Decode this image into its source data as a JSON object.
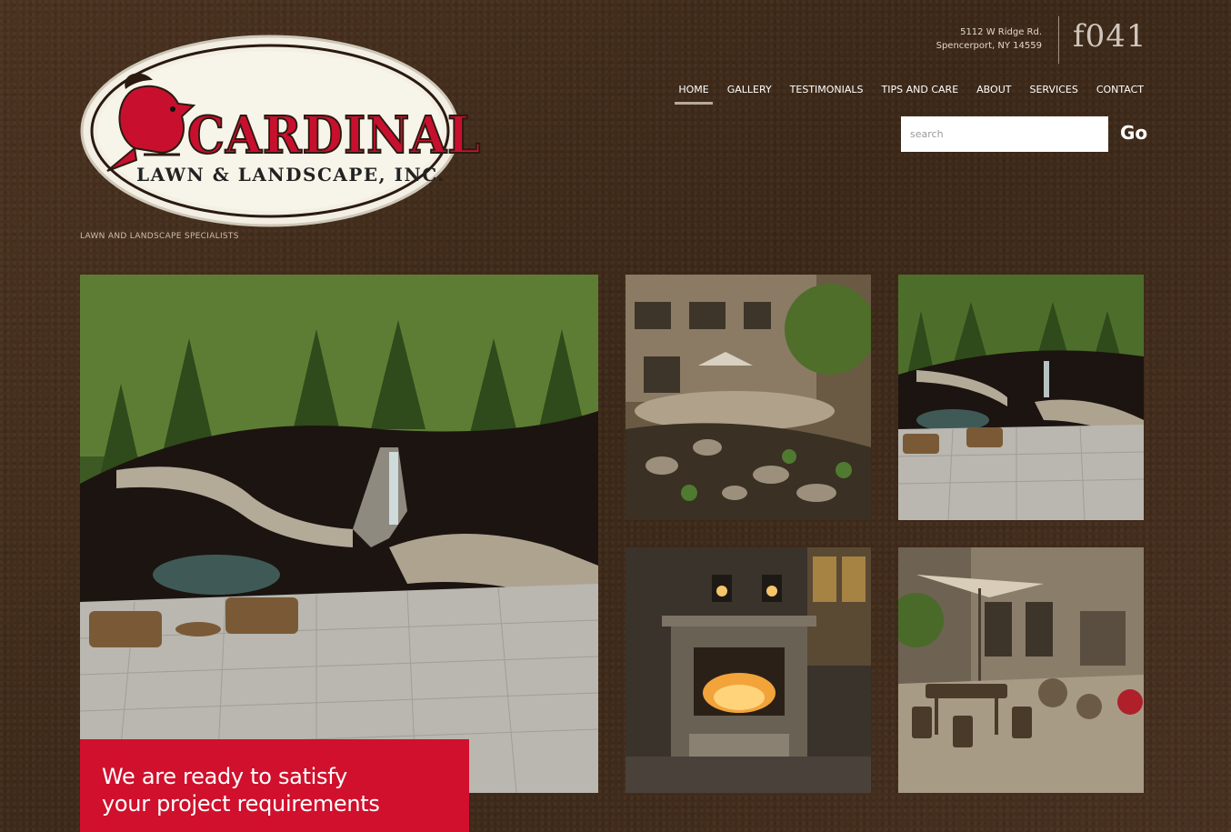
{
  "brand": {
    "name_main": "CARDINAL",
    "name_sub": "LAWN & LANDSCAPE, INC.",
    "tagline": "LAWN AND LANDSCAPE SPECIALISTS"
  },
  "header": {
    "address_line1": "5112 W Ridge Rd.",
    "address_line2": "Spencerport, NY 14559",
    "social_glyphs": "f041"
  },
  "nav": {
    "items": [
      {
        "label": "HOME",
        "active": true
      },
      {
        "label": "GALLERY",
        "active": false
      },
      {
        "label": "TESTIMONIALS",
        "active": false
      },
      {
        "label": "TIPS AND CARE",
        "active": false
      },
      {
        "label": "ABOUT",
        "active": false
      },
      {
        "label": "SERVICES",
        "active": false
      },
      {
        "label": "CONTACT",
        "active": false
      }
    ]
  },
  "search": {
    "placeholder": "search",
    "go_label": "Go"
  },
  "banner": {
    "line1": "We are ready to satisfy",
    "line2": "your project requirements"
  },
  "colors": {
    "background": "#3f2a1a",
    "accent_red": "#d0102c",
    "nav_text": "#ffffff"
  }
}
